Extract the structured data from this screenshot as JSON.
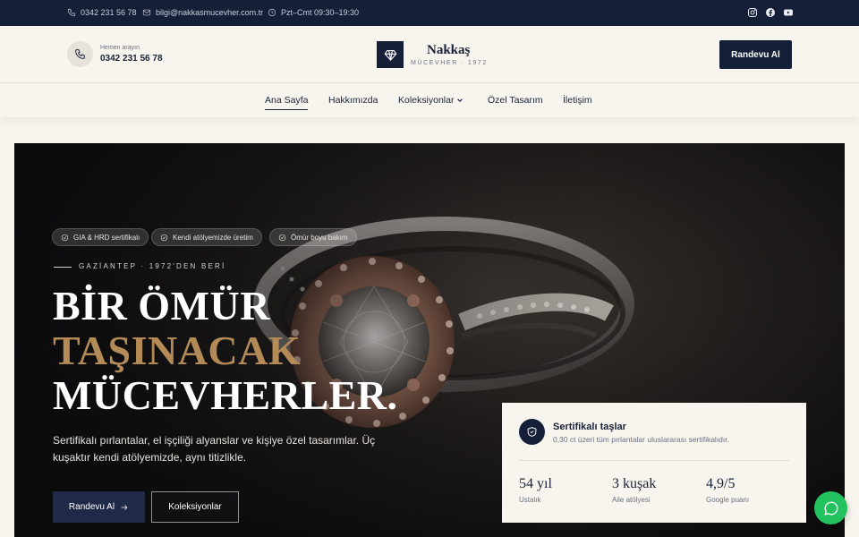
{
  "topbar": {
    "phone": "0342 231 56 78",
    "email": "bilgi@nakkasmucevher.com.tr",
    "hours": "Pzt–Cmt 09:30–19:30",
    "social_icons": [
      "instagram-icon",
      "facebook-icon",
      "youtube-icon"
    ]
  },
  "header": {
    "call_caption": "Hemen arayın",
    "call_number": "0342 231 56 78",
    "logo_name": "Nakkaş",
    "logo_sub": "MÜCEVHER · 1972",
    "cta_label": "Randevu Al"
  },
  "nav": {
    "items": [
      {
        "label": "Ana Sayfa",
        "active": true
      },
      {
        "label": "Hakkımızda",
        "active": false
      },
      {
        "label": "Koleksiyonlar",
        "active": false,
        "dropdown": true
      },
      {
        "label": "Özel Tasarım",
        "active": false
      },
      {
        "label": "İletişim",
        "active": false
      }
    ]
  },
  "hero": {
    "badges": [
      "GIA & HRD sertifikalı",
      "Kendi atölyemizde üretim",
      "Ömür boyu bakım"
    ],
    "eyebrow": "GAZİANTEP · 1972'DEN BERİ",
    "headline": [
      "BİR ÖMÜR",
      "TAŞINACAK",
      "MÜCEVHERLER."
    ],
    "description": "Sertifikalı pırlantalar, el işçiliği alyanslar ve kişiye özel tasarımlar. Üç kuşaktır kendi atölyemizde, aynı titizlikle.",
    "primary_button": "Randevu Al",
    "secondary_button": "Koleksiyonlar"
  },
  "card": {
    "title": "Sertifikalı taşlar",
    "description": "0,30 ct üzeri tüm pırlantalar uluslararası sertifikalıdır.",
    "stats": [
      {
        "value": "54 yıl",
        "label": "Ustalık"
      },
      {
        "value": "3 kuşak",
        "label": "Aile atölyesi"
      },
      {
        "value": "4,9/5",
        "label": "Google puanı"
      }
    ]
  },
  "colors": {
    "navy": "#161f38",
    "gold": "#b48a57",
    "cream": "#f8f5ef",
    "whatsapp": "#22c35e"
  }
}
